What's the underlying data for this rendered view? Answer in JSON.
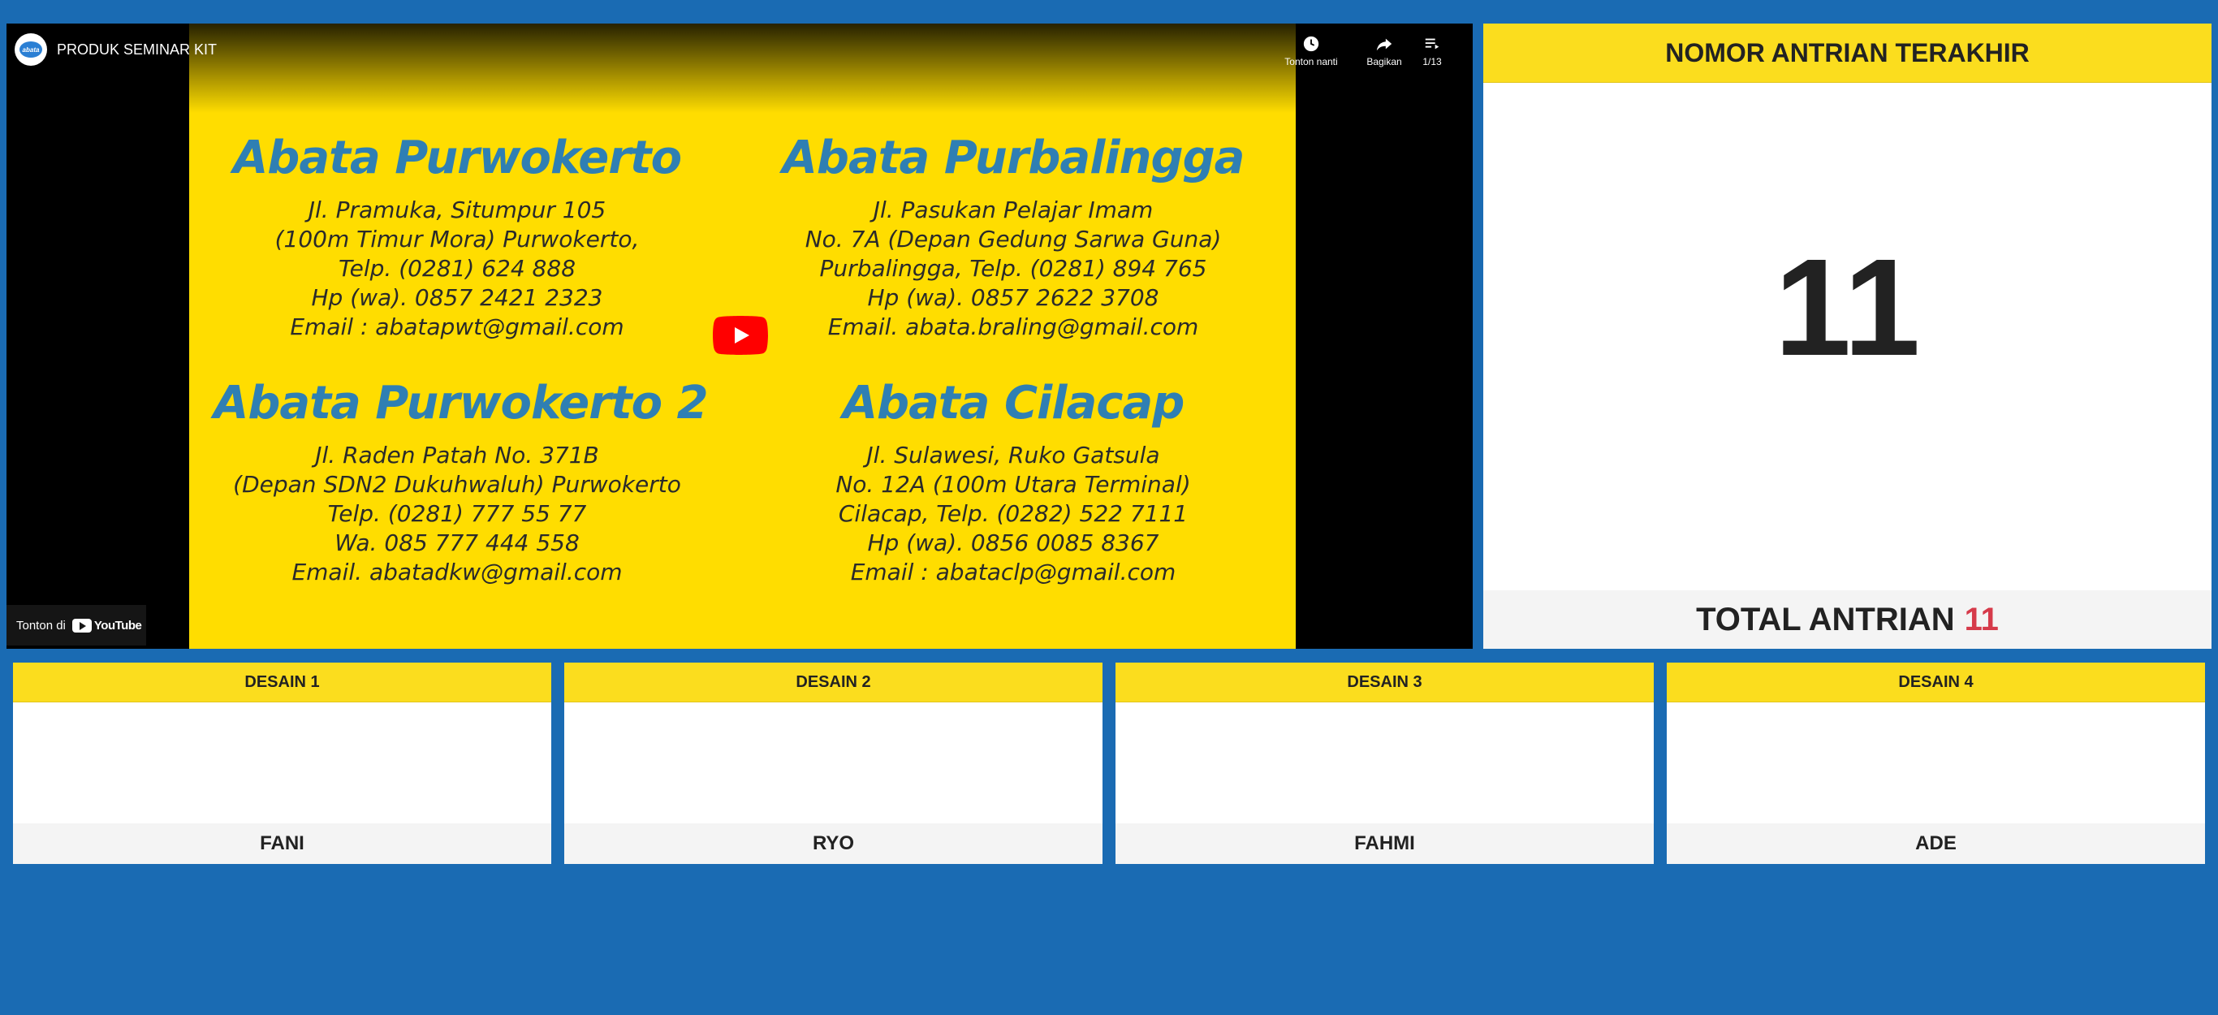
{
  "video": {
    "title": "PRODUK SEMINAR KIT",
    "channel_avatar_text": "abata",
    "actions": [
      {
        "icon": "clock-icon",
        "label": "Tonton nanti"
      },
      {
        "icon": "share-icon",
        "label": "Bagikan"
      },
      {
        "icon": "playlist-icon",
        "label": "1/13"
      }
    ],
    "watch_on_label": "Tonton di",
    "youtube_label": "YouTube",
    "slide": {
      "branches": [
        {
          "name": "Abata Purwokerto",
          "lines": [
            "Jl. Pramuka, Situmpur 105",
            "(100m Timur Mora) Purwokerto,",
            "Telp. (0281) 624 888",
            "Hp (wa). 0857 2421 2323",
            "Email : abatapwt@gmail.com"
          ]
        },
        {
          "name": "Abata Purbalingga",
          "lines": [
            "Jl. Pasukan Pelajar Imam",
            "No. 7A (Depan Gedung Sarwa Guna)",
            "Purbalingga, Telp. (0281) 894 765",
            "Hp (wa). 0857 2622 3708",
            "Email. abata.braling@gmail.com"
          ]
        },
        {
          "name": "Abata Purwokerto 2",
          "lines": [
            "Jl. Raden Patah No. 371B",
            "(Depan SDN2 Dukuhwaluh) Purwokerto",
            "Telp. (0281) 777 55 77",
            "Wa. 085 777 444 558",
            "Email. abatadkw@gmail.com"
          ]
        },
        {
          "name": "Abata Cilacap",
          "lines": [
            "Jl. Sulawesi, Ruko Gatsula",
            "No. 12A (100m Utara Terminal)",
            "Cilacap, Telp. (0282) 522 7111",
            "Hp (wa). 0856 0085 8367",
            "Email : abataclp@gmail.com"
          ]
        }
      ]
    },
    "colors": {
      "slide_bg": "#ffdd00",
      "branch_title": "#2f7fb3",
      "play_button": "#ff0000"
    }
  },
  "last_queue": {
    "header": "NOMOR ANTRIAN TERAKHIR",
    "number": "11",
    "total_label": "TOTAL ANTRIAN",
    "total_value": "11"
  },
  "designers": [
    {
      "title": "DESAIN 1",
      "name": "FANI"
    },
    {
      "title": "DESAIN 2",
      "name": "RYO"
    },
    {
      "title": "DESAIN 3",
      "name": "FAHMI"
    },
    {
      "title": "DESAIN 4",
      "name": "ADE"
    }
  ],
  "colors": {
    "page_bg": "#1a6bb3",
    "header_yellow": "#fbdd1e",
    "total_accent": "#d63a4a"
  }
}
